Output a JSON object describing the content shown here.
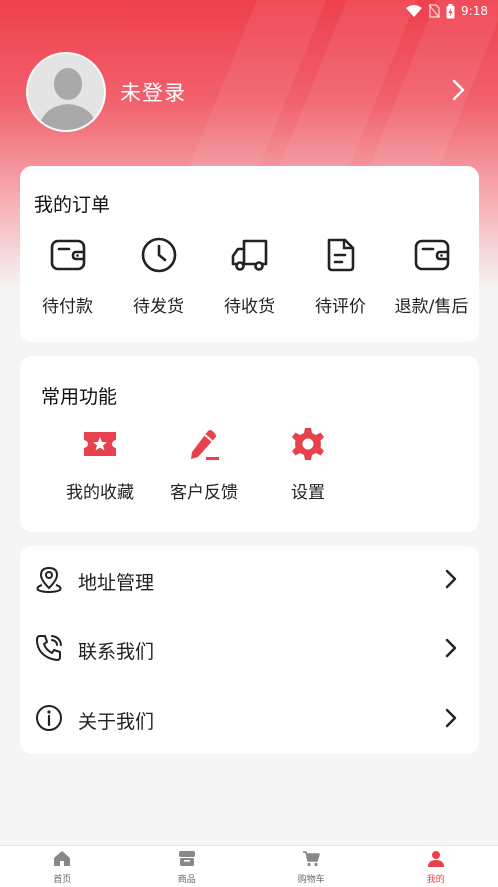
{
  "status_bar": {
    "time": "9:18"
  },
  "profile": {
    "username": "未登录"
  },
  "orders": {
    "title": "我的订单",
    "items": [
      {
        "label": "待付款",
        "icon": "wallet-icon"
      },
      {
        "label": "待发货",
        "icon": "clock-icon"
      },
      {
        "label": "待收货",
        "icon": "truck-icon"
      },
      {
        "label": "待评价",
        "icon": "document-icon"
      },
      {
        "label": "退款/售后",
        "icon": "wallet-icon"
      }
    ]
  },
  "functions": {
    "title": "常用功能",
    "items": [
      {
        "label": "我的收藏",
        "icon": "star-ticket-icon"
      },
      {
        "label": "客户反馈",
        "icon": "pen-icon"
      },
      {
        "label": "设置",
        "icon": "gear-icon"
      }
    ]
  },
  "menu": {
    "items": [
      {
        "label": "地址管理",
        "icon": "location-pin-icon"
      },
      {
        "label": "联系我们",
        "icon": "phone-icon"
      },
      {
        "label": "关于我们",
        "icon": "info-icon"
      }
    ]
  },
  "tabbar": {
    "items": [
      {
        "label": "首页",
        "icon": "home-icon"
      },
      {
        "label": "商品",
        "icon": "products-icon"
      },
      {
        "label": "购物车",
        "icon": "cart-icon"
      },
      {
        "label": "我的",
        "icon": "user-icon"
      }
    ],
    "active": "我的"
  },
  "colors": {
    "accent": "#e8414d",
    "header_top": "#ee3f4c",
    "background": "#f5f5f5",
    "card": "#ffffff"
  }
}
